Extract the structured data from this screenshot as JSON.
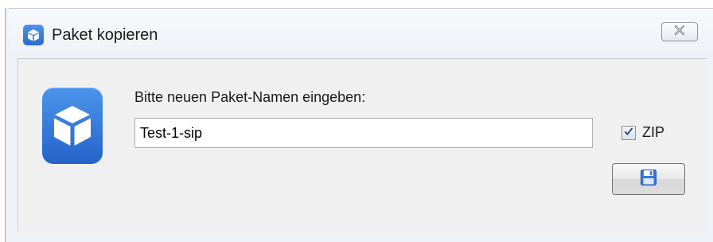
{
  "window": {
    "title": "Paket kopieren"
  },
  "titlebar": {
    "icon": "package-cube-icon",
    "close_icon": "close-x-icon"
  },
  "content": {
    "app_icon": "package-cube-icon",
    "prompt": "Bitte neuen Paket-Namen eingeben:",
    "name_value": "Test-1-sip",
    "zip_label": "ZIP",
    "zip_checked": true,
    "save_icon": "floppy-disk-icon"
  },
  "colors": {
    "accent_blue": "#2f72d6",
    "dialog_background": "#f0f0f0"
  }
}
